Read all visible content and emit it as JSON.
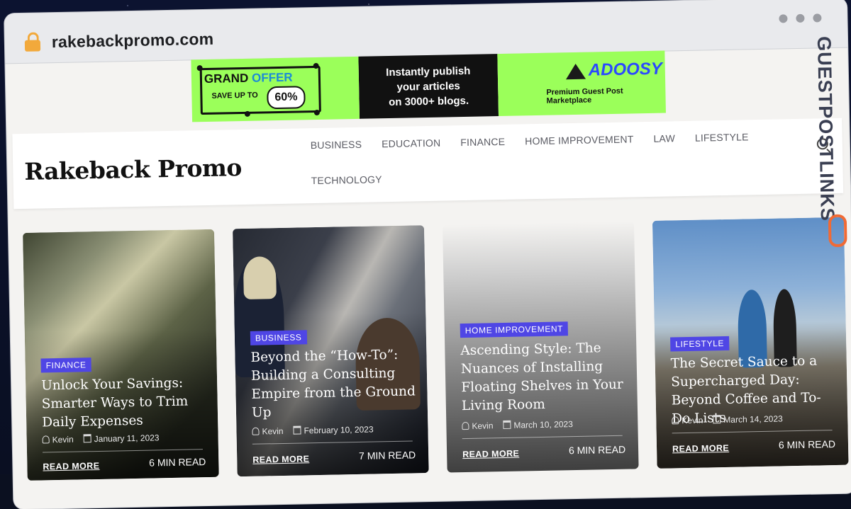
{
  "browser": {
    "url": "rakebackpromo.com"
  },
  "ad_banner": {
    "offer_title_1": "GRAND",
    "offer_title_2": "OFFER",
    "save_text": "SAVE UP TO",
    "percent": "60%",
    "middle_line_1": "Instantly publish",
    "middle_line_2": "your articles",
    "middle_line_3": "on 3000+ blogs.",
    "brand": "ADOOSY",
    "tagline": "Premium Guest Post Marketplace"
  },
  "site": {
    "logo": "Rakeback Promo",
    "nav": [
      "BUSINESS",
      "EDUCATION",
      "FINANCE",
      "HOME IMPROVEMENT",
      "LAW",
      "LIFESTYLE",
      "TECHNOLOGY"
    ]
  },
  "cards": [
    {
      "category": "FINANCE",
      "title": "Unlock Your Savings: Smarter Ways to Trim Daily Expenses",
      "author": "Kevin",
      "date": "January 11, 2023",
      "more": "READ MORE",
      "read_time": "6 MIN READ"
    },
    {
      "category": "BUSINESS",
      "title": "Beyond the “How-To”: Building a Consulting Empire from the Ground Up",
      "author": "Kevin",
      "date": "February 10, 2023",
      "more": "READ MORE",
      "read_time": "7 MIN READ"
    },
    {
      "category": "HOME IMPROVEMENT",
      "title": "Ascending Style: The Nuances of Installing Floating Shelves in Your Living Room",
      "author": "Kevin",
      "date": "March 10, 2023",
      "more": "READ MORE",
      "read_time": "6 MIN READ"
    },
    {
      "category": "LIFESTYLE",
      "title": "The Secret Sauce to a Supercharged Day: Beyond Coffee and To-Do Lists",
      "author": "Kevin",
      "date": "March 14, 2023",
      "more": "READ MORE",
      "read_time": "6 MIN READ"
    }
  ],
  "watermark": {
    "text": "GUESTPOSTLINKS"
  },
  "colors": {
    "tag": "#4f46e5",
    "banner_green": "#9bff5a",
    "lock": "#f2a93b",
    "watermark_link": "#f06a35"
  }
}
